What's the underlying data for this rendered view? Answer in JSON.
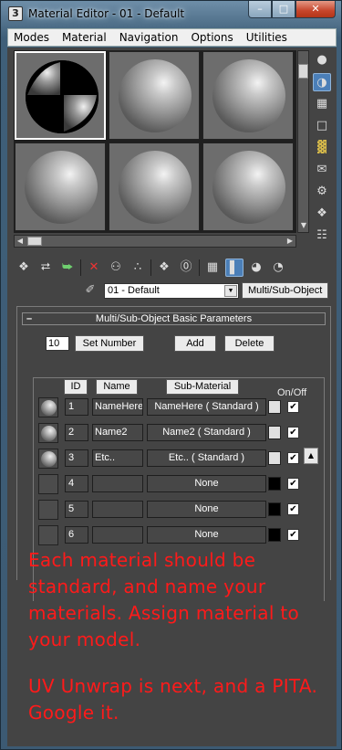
{
  "window": {
    "title": "Material Editor - 01 - Default",
    "app_icon": "3ds-max-icon",
    "controls": [
      "minimize",
      "maximize",
      "close"
    ]
  },
  "menu": [
    "Modes",
    "Material",
    "Navigation",
    "Options",
    "Utilities"
  ],
  "sample_slots": [
    {
      "type": "checker-sphere",
      "active": true
    },
    {
      "type": "sphere"
    },
    {
      "type": "sphere"
    },
    {
      "type": "sphere"
    },
    {
      "type": "sphere"
    },
    {
      "type": "sphere"
    }
  ],
  "right_toolbar": [
    "sample-type-icon",
    "backlight-icon",
    "background-icon",
    "uv-tiling-icon",
    "video-color-check-icon",
    "make-preview-icon",
    "options-icon",
    "select-by-material-icon",
    "material-map-navigator-icon"
  ],
  "bottom_toolbar": [
    "get-material-icon",
    "put-to-scene-icon",
    "assign-to-selection-icon",
    "reset-map-icon",
    "copy-material-icon",
    "make-unique-icon",
    "put-to-library-icon",
    "material-id-channel-icon",
    "show-map-in-viewport-icon",
    "show-end-result-icon",
    "go-to-parent-icon",
    "go-forward-icon"
  ],
  "material_name": "01 - Default",
  "material_type": "Multi/Sub-Object",
  "rollout": {
    "title": "Multi/Sub-Object Basic Parameters",
    "collapse_symbol": "–",
    "count": "10",
    "set_number": "Set Number",
    "add": "Add",
    "delete": "Delete",
    "headers": {
      "id": "ID",
      "name": "Name",
      "sub_material": "Sub-Material",
      "on_off": "On/Off"
    }
  },
  "rows": [
    {
      "id": "1",
      "name": "NameHere",
      "sub": "NameHere  ( Standard )",
      "has_ball": true,
      "swatch": "#e0e0e0",
      "on": true
    },
    {
      "id": "2",
      "name": "Name2",
      "sub": "Name2  ( Standard )",
      "has_ball": true,
      "swatch": "#e0e0e0",
      "on": true
    },
    {
      "id": "3",
      "name": "Etc..",
      "sub": "Etc..  ( Standard )",
      "has_ball": true,
      "swatch": "#e0e0e0",
      "on": true
    },
    {
      "id": "4",
      "name": "",
      "sub": "None",
      "has_ball": false,
      "swatch": "#000000",
      "on": true
    },
    {
      "id": "5",
      "name": "",
      "sub": "None",
      "has_ball": false,
      "swatch": "#000000",
      "on": true
    },
    {
      "id": "6",
      "name": "",
      "sub": "None",
      "has_ball": false,
      "swatch": "#000000",
      "on": true
    }
  ],
  "annotation": {
    "color": "#ff1a1a",
    "line1": "Each material should be standard, and name your materials. Assign material to your model.",
    "line2": "UV Unwrap is next, and a PITA. Google it."
  }
}
